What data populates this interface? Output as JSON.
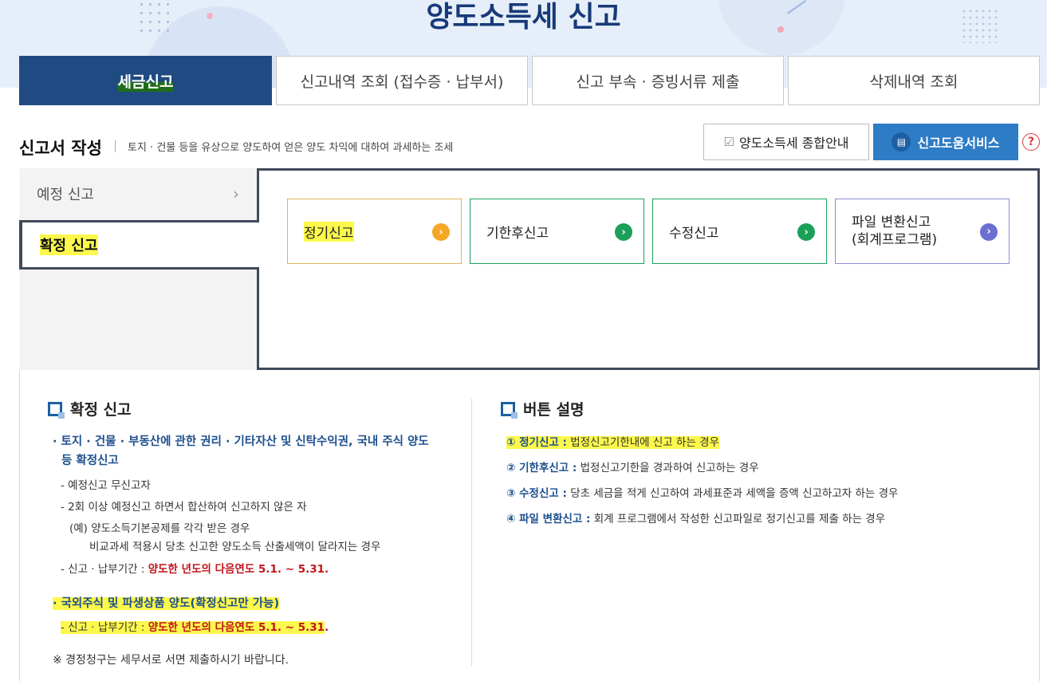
{
  "header": {
    "title": "양도소득세 신고"
  },
  "tabs": [
    {
      "label": "세금신고",
      "active": true
    },
    {
      "label": "신고내역 조회 (접수증 · 납부서)"
    },
    {
      "label": "신고 부속 · 증빙서류 제출"
    },
    {
      "label": "삭제내역 조회"
    }
  ],
  "section": {
    "title": "신고서 작성",
    "desc": "토지 · 건물 등을 유상으로 양도하여 얻은 양도 차익에 대하여 과세하는 조세"
  },
  "buttons": {
    "guide": "양도소득세 종합안내",
    "help": "신고도움서비스",
    "question": "?"
  },
  "sidebar": [
    {
      "label": "예정 신고"
    },
    {
      "label": "확정 신고",
      "active": true
    }
  ],
  "choices": [
    {
      "label": "정기신고",
      "color": "#f5a623"
    },
    {
      "label": "기한후신고",
      "color": "#1aa058"
    },
    {
      "label": "수정신고",
      "color": "#1aa058"
    },
    {
      "label_line1": "파일 변환신고",
      "label_line2": "(회계프로그램)",
      "color": "#6b6fcf"
    }
  ],
  "left_block": {
    "title": "확정 신고",
    "item1_line1": "· 토지 · 건물 · 부동산에 관한 권리 · 기타자산 및 신탁수익권, 국내 주식 양도",
    "item1_line2": "등 확정신고",
    "sub1": "- 예정신고 무신고자",
    "sub2": "- 2회 이상 예정신고 하면서 합산하여 신고하지 않은 자",
    "sub3": "(예) 양도소득기본공제를 각각 받은 경우",
    "sub4": "비교과세 적용시 당초 신고한 양도소득 산출세액이 달라지는 경우",
    "period_label": "- 신고 · 납부기간 : ",
    "period_value": "양도한 년도의 다음연도 5.1. ~ 5.31.",
    "item2": "· 국외주식 및 파생상품 양도(확정신고만 가능)",
    "period2_label": "- 신고 · 납부기간 : ",
    "period2_value": "양도한 년도의 다음연도 5.1. ~ 5.31",
    "period2_dot": ".",
    "note": "※ 경정청구는 세무서로 서면 제출하시기 바랍니다."
  },
  "right_block": {
    "title": "버튼 설명",
    "items": [
      {
        "term": "① 정기신고 :",
        "desc": " 법정신고기한내에 신고 하는 경우"
      },
      {
        "term": "② 기한후신고 :",
        "desc": " 법정신고기한을 경과하여 신고하는 경우"
      },
      {
        "term": "③ 수정신고 :",
        "desc": " 당초 세금을 적게 신고하여 과세표준과 세액을 증액 신고하고자 하는 경우"
      },
      {
        "term": "④ 파일 변환신고 :",
        "desc": " 회계 프로그램에서 작성한 신고파일로 정기신고를  제출 하는 경우"
      }
    ]
  }
}
